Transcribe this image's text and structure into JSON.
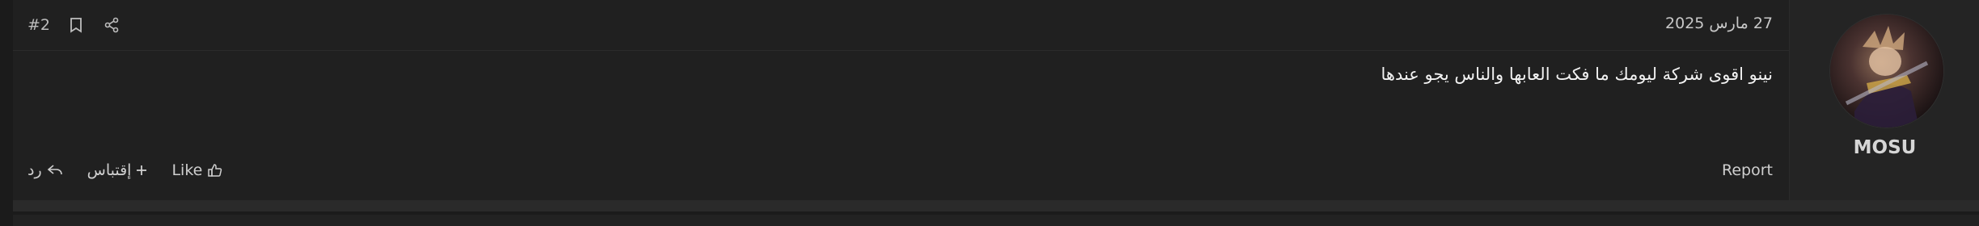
{
  "post": {
    "number": "#2",
    "date": "27 مارس 2025",
    "body": "نينو اقوى شركة ليومك ما فكت العابها والناس يجو عندها",
    "actions": {
      "reply_label": "رد",
      "quote_label": "إقتباس",
      "like_label": "Like",
      "report_label": "Report"
    }
  },
  "user": {
    "name": "MOSU"
  },
  "icons": {
    "share": "share-icon",
    "bookmark": "bookmark-icon",
    "reply": "reply-icon",
    "quote": "plus-icon",
    "like": "thumbs-up-icon"
  }
}
